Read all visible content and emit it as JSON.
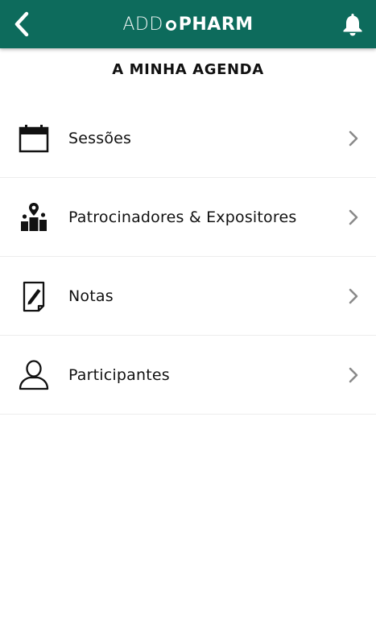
{
  "header": {
    "brand_light": "ADD",
    "brand_bold": "PHARM",
    "back_icon": "chevron-left-icon",
    "notification_icon": "bell-icon",
    "bar_color": "#0d6b5c"
  },
  "page": {
    "title": "A MINHA AGENDA"
  },
  "menu": {
    "items": [
      {
        "label": "Sessões",
        "icon": "calendar-icon"
      },
      {
        "label": "Patrocinadores & Expositores",
        "icon": "podium-pin-icon"
      },
      {
        "label": "Notas",
        "icon": "note-pencil-icon"
      },
      {
        "label": "Participantes",
        "icon": "person-icon"
      }
    ]
  }
}
